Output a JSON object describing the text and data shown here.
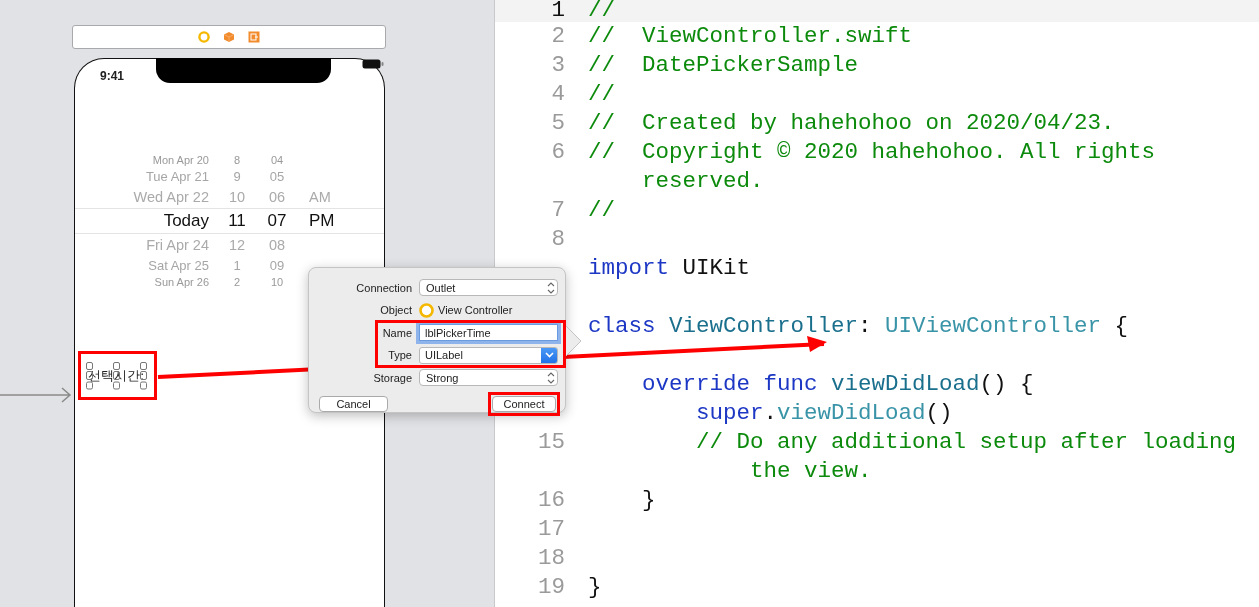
{
  "storyboard": {
    "status_time": "9:41",
    "picker": {
      "rows": [
        {
          "date": "Mon Apr 20",
          "hour": "8",
          "minute": "04",
          "selected": false
        },
        {
          "date": "Tue Apr 21",
          "hour": "9",
          "minute": "05",
          "selected": false
        },
        {
          "date": "Wed Apr 22",
          "hour": "10",
          "minute": "06",
          "period": "AM",
          "selected": false
        },
        {
          "date": "Today",
          "hour": "11",
          "minute": "07",
          "period": "PM",
          "selected": true
        },
        {
          "date": "Fri Apr 24",
          "hour": "12",
          "minute": "08",
          "selected": false
        },
        {
          "date": "Sat Apr 25",
          "hour": "1",
          "minute": "09",
          "selected": false
        },
        {
          "date": "Sun Apr 26",
          "hour": "2",
          "minute": "10",
          "selected": false
        }
      ]
    },
    "label": {
      "text": "선택시간:",
      "selected": true,
      "highlighted": true
    }
  },
  "popup": {
    "fields": [
      {
        "kind": "select",
        "label": "Connection",
        "value": "Outlet",
        "highlighted": false
      },
      {
        "kind": "object",
        "label": "Object",
        "value": "View Controller",
        "highlighted": false
      },
      {
        "kind": "text",
        "label": "Name",
        "value": "lblPickerTime",
        "focused": true,
        "highlighted": true
      },
      {
        "kind": "combo",
        "label": "Type",
        "value": "UILabel",
        "highlighted": true
      },
      {
        "kind": "select",
        "label": "Storage",
        "value": "Strong",
        "highlighted": false
      }
    ],
    "buttons": [
      {
        "label": "Cancel",
        "highlighted": false
      },
      {
        "label": "Connect",
        "highlighted": true
      }
    ]
  },
  "editor": {
    "lines": [
      {
        "number": "1",
        "current": true,
        "segments": [
          {
            "kind": "comment",
            "text": "//"
          }
        ]
      },
      {
        "number": "2",
        "current": false,
        "segments": [
          {
            "kind": "comment",
            "text": "//  ViewController.swift"
          }
        ]
      },
      {
        "number": "3",
        "current": false,
        "segments": [
          {
            "kind": "comment",
            "text": "//  DatePickerSample"
          }
        ]
      },
      {
        "number": "4",
        "current": false,
        "segments": [
          {
            "kind": "comment",
            "text": "//"
          }
        ]
      },
      {
        "number": "5",
        "current": false,
        "segments": [
          {
            "kind": "comment",
            "text": "//  Created by hahehohoo on 2020/04/23."
          }
        ]
      },
      {
        "number": "6",
        "current": false,
        "segments": [
          {
            "kind": "comment",
            "text": "//  Copyright © 2020 hahehohoo. All rights"
          }
        ],
        "wrap": "reserved."
      },
      {
        "number": "7",
        "current": false,
        "segments": [
          {
            "kind": "comment",
            "text": "//"
          }
        ]
      },
      {
        "number": "8",
        "current": false
      },
      {
        "current": false,
        "segments": [
          {
            "kind": "keyword",
            "text": "import"
          },
          {
            "kind": "plain",
            "text": " UIKit"
          }
        ]
      },
      {
        "current": false
      },
      {
        "current": false,
        "segments": [
          {
            "kind": "keyword",
            "text": "class "
          },
          {
            "kind": "declaration",
            "text": "ViewController"
          },
          {
            "kind": "plain",
            "text": ": "
          },
          {
            "kind": "type",
            "text": "UIViewController"
          },
          {
            "kind": "plain",
            "text": " {"
          }
        ]
      },
      {
        "current": false
      },
      {
        "current": false,
        "segments": [
          {
            "kind": "keyword",
            "text": "    override func "
          },
          {
            "kind": "declaration",
            "text": "viewDidLoad"
          },
          {
            "kind": "plain",
            "text": "() {"
          }
        ]
      },
      {
        "current": false,
        "segments": [
          {
            "kind": "keyword",
            "text": "        super"
          },
          {
            "kind": "plain",
            "text": "."
          },
          {
            "kind": "type",
            "text": "viewDidLoad"
          },
          {
            "kind": "plain",
            "text": "()"
          }
        ]
      },
      {
        "number": "15",
        "current": false,
        "segments": [
          {
            "kind": "comment",
            "text": "        // Do any additional setup after loading"
          }
        ],
        "wrap": "the view."
      },
      {
        "number": "16",
        "current": false,
        "segments": [
          {
            "kind": "plain",
            "text": "    }"
          }
        ]
      },
      {
        "number": "17",
        "current": false
      },
      {
        "number": "18",
        "current": false
      },
      {
        "number": "19",
        "current": false,
        "segments": [
          {
            "kind": "plain",
            "text": "}"
          }
        ]
      }
    ]
  }
}
